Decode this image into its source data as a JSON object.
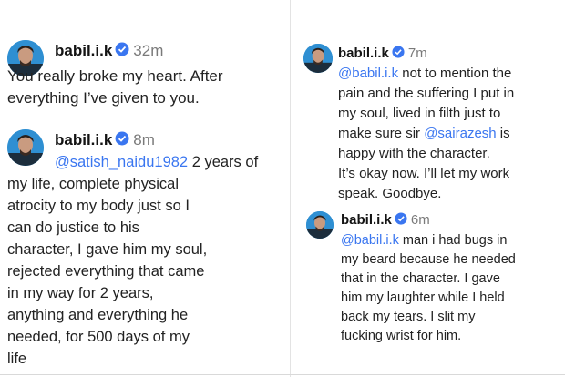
{
  "brand": {
    "link_color": "#3a76f0",
    "verified_color": "#3a76f0"
  },
  "posts": [
    {
      "username": "babil.i.k",
      "time": "32m",
      "lines": [
        {
          "text": "You really broke my heart. After"
        },
        {
          "text": "everything I’ve given to you."
        }
      ]
    },
    {
      "username": "babil.i.k",
      "time": "8m",
      "lines": [
        {
          "mention": "@satish_naidu1982",
          "text": " 2 years of"
        },
        {
          "text": "my life, complete physical"
        },
        {
          "text": "atrocity to my body just so I"
        },
        {
          "text": "can do justice to his"
        },
        {
          "text": "character, I gave him my soul,"
        },
        {
          "text": "rejected everything that came"
        },
        {
          "text": "in my way for 2 years,"
        },
        {
          "text": "anything and everything he"
        },
        {
          "text": "needed, for 500 days of my"
        },
        {
          "text": "life"
        }
      ]
    },
    {
      "username": "babil.i.k",
      "time": "7m",
      "lines": [
        {
          "mention": "@babil.i.k",
          "text": " not to mention the"
        },
        {
          "text": "pain and the suffering I put in"
        },
        {
          "text": "my soul, lived in filth just to"
        },
        {
          "text": "make sure sir ",
          "mention_after": "@sairazesh",
          "text_after": " is"
        },
        {
          "text": "happy with the character."
        },
        {
          "text": "It’s okay now. I’ll let my work"
        },
        {
          "text": "speak. Goodbye."
        }
      ]
    },
    {
      "username": "babil.i.k",
      "time": "6m",
      "lines": [
        {
          "mention": "@babil.i.k",
          "text": " man i had bugs in"
        },
        {
          "text": "my beard because he needed"
        },
        {
          "text": "that in the character. I gave"
        },
        {
          "text": "him my laughter while I held"
        },
        {
          "text": "back my tears. I slit my"
        },
        {
          "text": "fucking wrist for him."
        }
      ]
    }
  ]
}
